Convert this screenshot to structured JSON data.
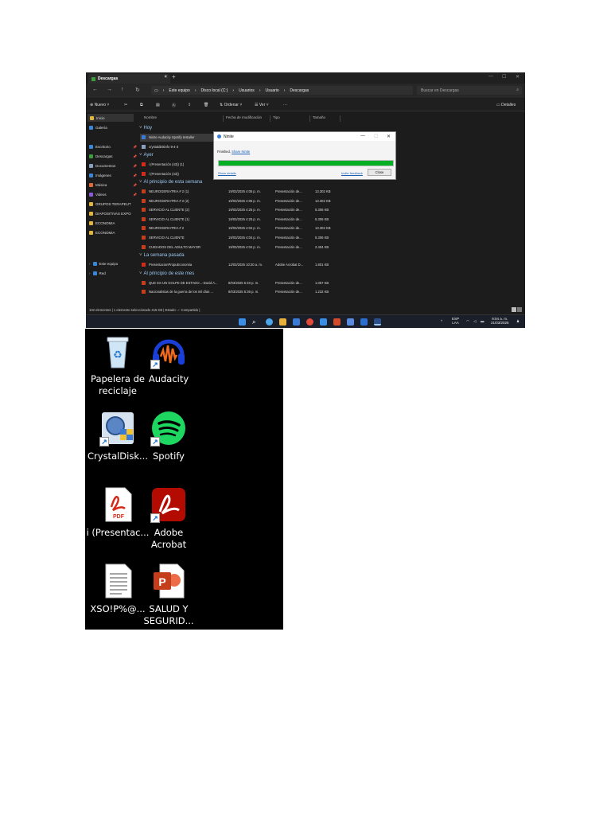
{
  "window": {
    "tab_title": "Descargas",
    "breadcrumb": [
      "Este equipo",
      "Disco local (C:)",
      "Usuarios",
      "Usuario",
      "Descargas"
    ],
    "search_placeholder": "Buscar en Descargas"
  },
  "toolbar": {
    "new_label": "Nuevo",
    "sort_label": "Ordenar",
    "view_label": "Ver",
    "more_label": "···",
    "details_label": "Detalles"
  },
  "sidebar": {
    "items": [
      {
        "label": "Inicio",
        "color": "#e0b640"
      },
      {
        "label": "Galería",
        "color": "#3a86d9"
      },
      {
        "label": "Escritorio",
        "color": "#3a86d9",
        "pinned": true
      },
      {
        "label": "Descargas",
        "color": "#3c9b3c",
        "pinned": true
      },
      {
        "label": "Documentos",
        "color": "#8aa0c0",
        "pinned": true
      },
      {
        "label": "Imágenes",
        "color": "#3a86d9",
        "pinned": true
      },
      {
        "label": "Música",
        "color": "#e06a3a",
        "pinned": true
      },
      {
        "label": "Videos",
        "color": "#8a5ad9",
        "pinned": true
      },
      {
        "label": "GRUPOS TERAPEUT",
        "color": "#e0b640"
      },
      {
        "label": "DIAPOSITIVAS EXPO",
        "color": "#e0b640"
      },
      {
        "label": "ECONOMIA",
        "color": "#e0b640"
      },
      {
        "label": "ECONOMIA",
        "color": "#e0b640"
      },
      {
        "label": "Este equipo",
        "color": "#3a86d9"
      },
      {
        "label": "Red",
        "color": "#3a86d9"
      }
    ],
    "pin_glyph": "📌"
  },
  "columns": [
    "Nombre",
    "Fecha de modificación",
    "Tipo",
    "Tamaño"
  ],
  "groups": {
    "hoy": "Hoy",
    "ayer": "Ayer",
    "semana": "Al principio de esta semana",
    "pasada": "La semana pasada",
    "mes": "Al principio de este mes"
  },
  "files": {
    "hoy": [
      {
        "name": "Ninite Audacity Spotify Installer"
      },
      {
        "name": "crystaldiskinfo 9-4-3"
      }
    ],
    "ayer": [
      {
        "name": "i (Presentación (43)) (1)"
      },
      {
        "name": "i (Presentación (43))"
      }
    ],
    "semana": [
      {
        "name": "NEUROGERIATRIA # 2 (1)",
        "date": "19/03/2025 4:05 p. m.",
        "type": "Presentación de...",
        "size": "13.302 KB"
      },
      {
        "name": "NEUROGERIATRIA # 2 (2)",
        "date": "19/03/2025 4:05 p. m.",
        "type": "Presentación de...",
        "size": "13.302 KB"
      },
      {
        "name": "SERVICIO AL CLIENTE (2)",
        "date": "19/03/2025 4:25 p. m.",
        "type": "Presentación de...",
        "size": "5.306 KB"
      },
      {
        "name": "SERVICIO AL CLIENTE (1)",
        "date": "19/03/2025 4:25 p. m.",
        "type": "Presentación de...",
        "size": "5.306 KB"
      },
      {
        "name": "NEUROGERIATRIA # 2",
        "date": "19/03/2025 4:04 p. m.",
        "type": "Presentación de...",
        "size": "13.302 KB"
      },
      {
        "name": "SERVICIO AL CLIENTE",
        "date": "19/03/2025 4:04 p. m.",
        "type": "Presentación de...",
        "size": "5.306 KB"
      },
      {
        "name": "CUIDADOS DEL ADULTO MAYOR",
        "date": "19/03/2025 4:04 p. m.",
        "type": "Presentación de...",
        "size": "2.404 KB"
      }
    ],
    "pasada": [
      {
        "name": "PresentacionPropuEconomia",
        "date": "12/03/2025 10:20 a. m.",
        "type": "Adobe Acrobat D...",
        "size": "1.801 KB"
      }
    ],
    "mes": [
      {
        "name": "QUE ES UN GOLPE DE ESTADO...-David A...",
        "date": "8/03/2025 5:40 p. m.",
        "type": "Presentación de...",
        "size": "1.057 KB"
      },
      {
        "name": "Nacionalistas de la guerra de los mil días ...",
        "date": "8/03/2025 5:36 p. m.",
        "type": "Presentación de...",
        "size": "1.232 KB"
      }
    ]
  },
  "status_text": "102 elementos  |  1 elemento seleccionado  415 KB  |  Estado: ✓ Compartido  |",
  "dialog": {
    "title": "Ninite",
    "message_prefix": "Finished.",
    "message_link": "Share Ninite",
    "progress": 1.0,
    "progress_color": "#06b025",
    "link_details": "Show details",
    "link_feedback": "Invite feedback",
    "close_label": "Close"
  },
  "tray": {
    "lang_top": "ESP",
    "lang_bottom": "LAA",
    "time": "9:04 a. m.",
    "date": "21/03/2025"
  },
  "desktop": [
    {
      "label": "Papelera de reciclaje",
      "icon": "recycle-bin-icon",
      "shortcut": false
    },
    {
      "label": "Audacity",
      "icon": "audacity-icon",
      "shortcut": true
    },
    {
      "label": "CrystalDisk...",
      "icon": "crystaldisk-icon",
      "shortcut": true
    },
    {
      "label": "Spotify",
      "icon": "spotify-icon",
      "shortcut": true
    },
    {
      "label": "i (Presentac...",
      "icon": "pdf-file-icon",
      "shortcut": false
    },
    {
      "label": "Adobe Acrobat",
      "icon": "adobe-acrobat-icon",
      "shortcut": true
    },
    {
      "label": "XSO!P%@...",
      "icon": "text-document-icon",
      "shortcut": false
    },
    {
      "label": "SALUD Y SEGURID...",
      "icon": "powerpoint-file-icon",
      "shortcut": false
    }
  ]
}
